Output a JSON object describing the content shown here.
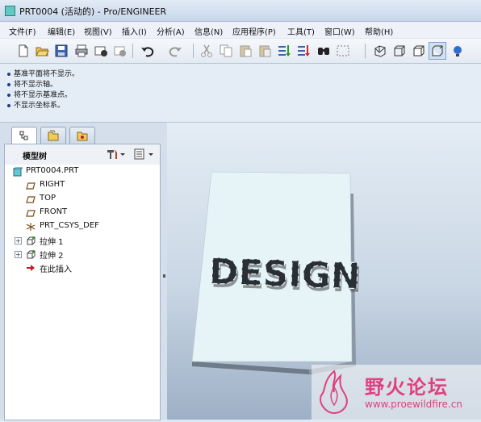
{
  "window": {
    "title": "PRT0004 (活动的) - Pro/ENGINEER"
  },
  "menu": [
    "文件(F)",
    "编辑(E)",
    "视图(V)",
    "插入(I)",
    "分析(A)",
    "信息(N)",
    "应用程序(P)",
    "工具(T)",
    "窗口(W)",
    "帮助(H)"
  ],
  "toolbar": {
    "icons": [
      "new-file-icon",
      "open-folder-icon",
      "save-icon",
      "print-icon",
      "send-mail-icon",
      "mail-recipient-icon",
      "undo-icon",
      "redo-icon",
      "cut-icon",
      "copy-icon",
      "paste-icon",
      "paste-special-icon",
      "regenerate-icon",
      "regenerate-manager-icon",
      "find-icon",
      "select-box-icon",
      "shading-icon",
      "hidden-line-icon",
      "no-hidden-icon",
      "wireframe-icon",
      "model-display-icon"
    ]
  },
  "messages": [
    "基准平面将不显示。",
    "将不显示轴。",
    "将不显示基准点。",
    "不显示坐标系。"
  ],
  "navigator": {
    "tabs": [
      "model-tree-tab-icon",
      "folder-browser-tab-icon",
      "favorites-tab-icon"
    ],
    "header_label": "模型树",
    "tree": [
      {
        "label": "PRT0004.PRT",
        "icon": "part-icon",
        "indent": 0,
        "expander": ""
      },
      {
        "label": "RIGHT",
        "icon": "datum-plane-icon",
        "indent": 1,
        "expander": ""
      },
      {
        "label": "TOP",
        "icon": "datum-plane-icon",
        "indent": 1,
        "expander": ""
      },
      {
        "label": "FRONT",
        "icon": "datum-plane-icon",
        "indent": 1,
        "expander": ""
      },
      {
        "label": "PRT_CSYS_DEF",
        "icon": "coordinate-system-icon",
        "indent": 1,
        "expander": ""
      },
      {
        "label": "拉伸 1",
        "icon": "extrude-icon",
        "indent": 1,
        "expander": "+"
      },
      {
        "label": "拉伸 2",
        "icon": "extrude-icon",
        "indent": 1,
        "expander": "+"
      },
      {
        "label": "在此插入",
        "icon": "insert-here-icon",
        "indent": 1,
        "expander": ""
      }
    ]
  },
  "model": {
    "embossed_text": "DESIGN",
    "face_color": "#e6f4f8"
  },
  "watermark": {
    "cn_text": "野火论坛",
    "url": "www.proewildfire.cn",
    "brand_color": "#e0407f"
  },
  "colors": {
    "accent": "#1d3f8c",
    "tree_icon": "#7a4a12"
  }
}
